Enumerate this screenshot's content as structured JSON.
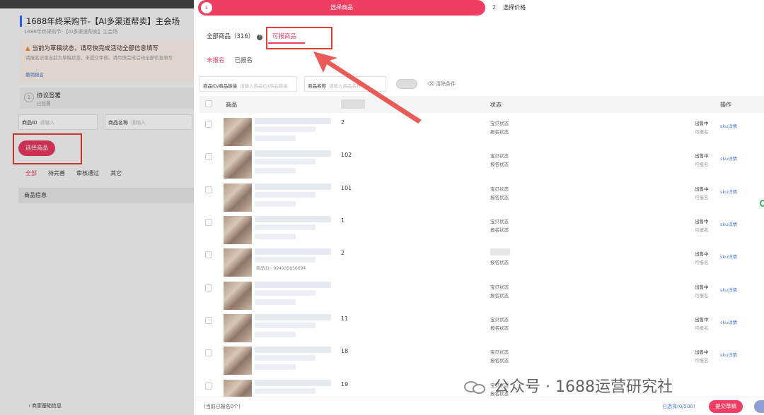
{
  "left": {
    "title": "1688年终采购节-【AI多渠道帮卖】主会场",
    "subtitle": "1688年终采购节-【AI多渠道帮卖】主会场",
    "notice_title": "当前为草稿状态，请尽快完成活动全部信息填写",
    "notice_desc": "请报名记录当前为草稿状态，未提交审核。请尽快完成活动全部信息填写",
    "notice_link": "撤销报名",
    "step_num": "1",
    "step_label": "协议签署",
    "step_sub": "已签署",
    "field_id_label": "商品ID",
    "field_id_placeholder": "请输入",
    "field_name_label": "商品名称",
    "field_name_placeholder": "请输入",
    "select_btn": "选择商品",
    "tabs": [
      "全部",
      "待完善",
      "审核通过",
      "其它"
    ],
    "info_head": "商品信息",
    "back_link": "商家基础信息"
  },
  "drawer": {
    "step1_num": "1",
    "step1_label": "选择商品",
    "step2_num": "2",
    "step2_label": "选择价格",
    "tab_all": "全部商品（316）",
    "tab_available": "可报商品",
    "sub_tab_unreg": "未报名",
    "sub_tab_reg": "已报名",
    "filter_id_label": "商品ID/商品链接",
    "filter_id_placeholder": "请输入商品ID/商品链接",
    "filter_name_label": "商品名称",
    "filter_name_placeholder": "请输入商品名称",
    "clear_label": "清除条件",
    "col_goods": "商品",
    "col_status": "状态",
    "col_op": "操作",
    "rows": [
      {
        "num": "2",
        "status1": "宝贝状态",
        "status2": "报名状态",
        "sell": "出售中",
        "rep": "可报名",
        "sku": "sku详情",
        "pid": ""
      },
      {
        "num": "102",
        "status1": "宝贝状态",
        "status2": "报名状态",
        "sell": "出售中",
        "rep": "可报名",
        "sku": "sku详情",
        "pid": ""
      },
      {
        "num": "101",
        "status1": "宝贝状态",
        "status2": "报名状态",
        "sell": "出售中",
        "rep": "可报名",
        "sku": "sku详情",
        "pid": ""
      },
      {
        "num": "1",
        "status1": "宝贝状态",
        "status2": "报名状态",
        "sell": "出售中",
        "rep": "可报名",
        "sku": "sku详情",
        "pid": ""
      },
      {
        "num": "2",
        "status1": "",
        "status2": "报名状态",
        "sell": "出售中",
        "rep": "可报名",
        "sku": "sku详情",
        "pid": "商品ID：994935856694"
      },
      {
        "num": "",
        "status1": "宝贝状态",
        "status2": "报名状态",
        "sell": "出售中",
        "rep": "可报名",
        "sku": "sku详情",
        "pid": ""
      },
      {
        "num": "11",
        "status1": "宝贝状态",
        "status2": "报名状态",
        "sell": "出售中",
        "rep": "可报名",
        "sku": "sku详情",
        "pid": ""
      },
      {
        "num": "18",
        "status1": "宝贝状态",
        "status2": "报名状态",
        "sell": "出售中",
        "rep": "可报名",
        "sku": "sku详情",
        "pid": ""
      },
      {
        "num": "19",
        "status1": "宝贝状态",
        "status2": "报名状态",
        "sell": "",
        "rep": "",
        "sku": "",
        "pid": ""
      }
    ],
    "footer_current": "(当前已报名0个)",
    "footer_selected": "已选择(0/500)",
    "footer_submit": "提交草稿"
  },
  "watermark": "公众号 · 1688运营研究社",
  "colors": {
    "accent": "#f03e62",
    "annotation": "#e23e36",
    "link": "#4a7bd8"
  }
}
